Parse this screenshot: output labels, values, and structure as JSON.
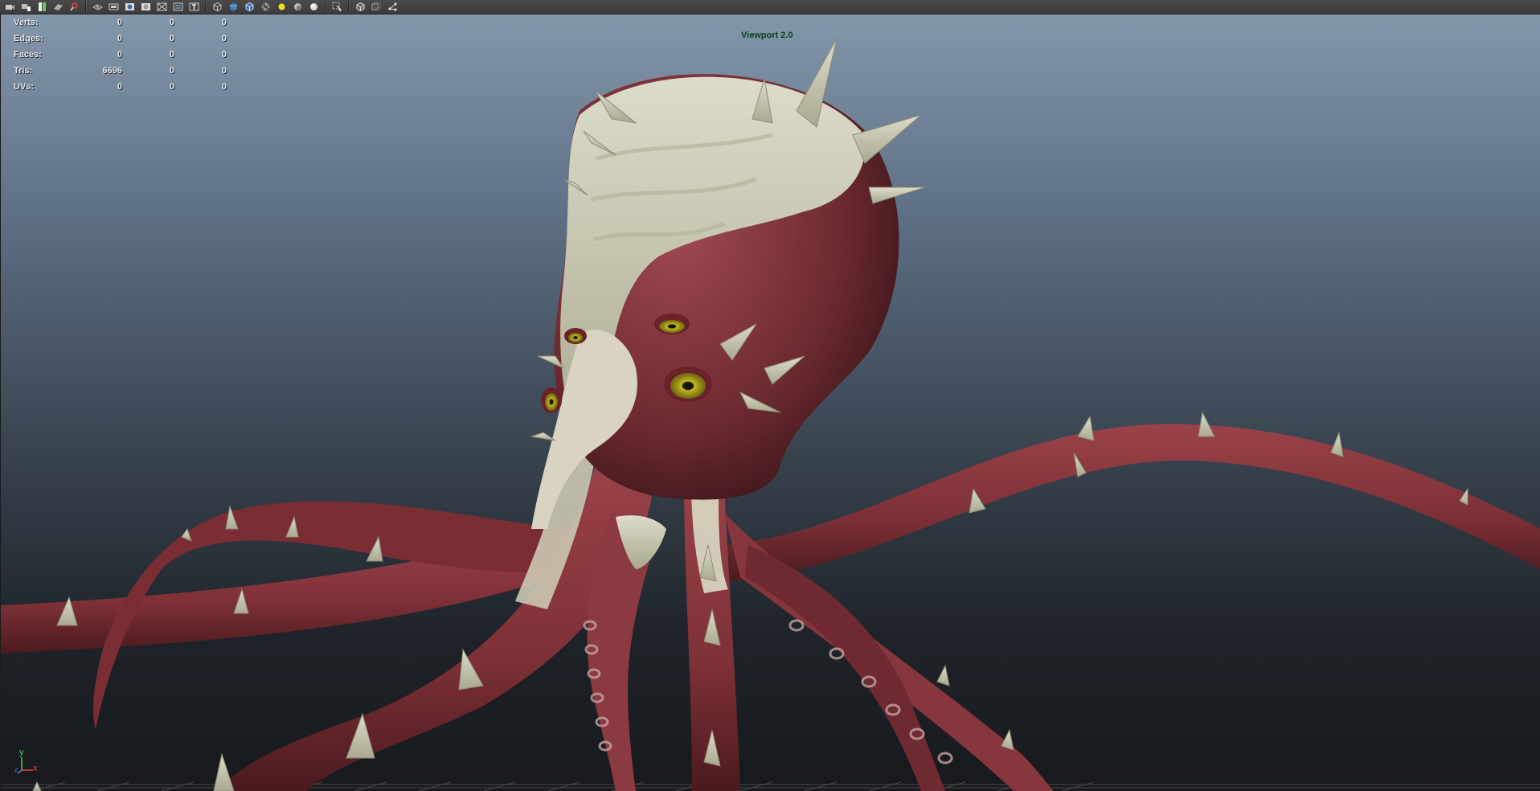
{
  "toolbar": {
    "icons": [
      "camera-select-icon",
      "camera-attributes-icon",
      "bookmark-icon",
      "image-plane-icon",
      "2d-pan-zoom-icon",
      "sep",
      "grid-icon",
      "film-gate-icon",
      "resolution-gate-icon",
      "gate-mask-icon",
      "field-chart-icon",
      "safe-action-icon",
      "safe-title-icon",
      "sep",
      "wireframe-icon",
      "smooth-shade-icon",
      "shade-wireframe-icon",
      "textured-icon",
      "default-light-icon",
      "shadows-icon",
      "ambient-occlusion-icon",
      "sep",
      "xray-icon",
      "sep",
      "isolate-select-icon",
      "xray-joints-icon",
      "xray-active-icon"
    ]
  },
  "hud": {
    "rows": [
      {
        "label": "Verts:",
        "a": "0",
        "b": "0",
        "c": "0"
      },
      {
        "label": "Edges:",
        "a": "0",
        "b": "0",
        "c": "0"
      },
      {
        "label": "Faces:",
        "a": "0",
        "b": "0",
        "c": "0"
      },
      {
        "label": "Tris:",
        "a": "6696",
        "b": "0",
        "c": "0"
      },
      {
        "label": "UVs:",
        "a": "0",
        "b": "0",
        "c": "0"
      }
    ]
  },
  "viewport": {
    "renderer": "Viewport 2.0"
  },
  "axis": {
    "y": "y",
    "x": "x",
    "z": "z"
  },
  "colors": {
    "skin": "#8a3a40",
    "skin_dark": "#4a1a1e",
    "bone": "#cfcdb6",
    "eye": "#b3a81a",
    "hud_text": "#e8e8e8",
    "renderer_text": "#0e3b1f"
  }
}
